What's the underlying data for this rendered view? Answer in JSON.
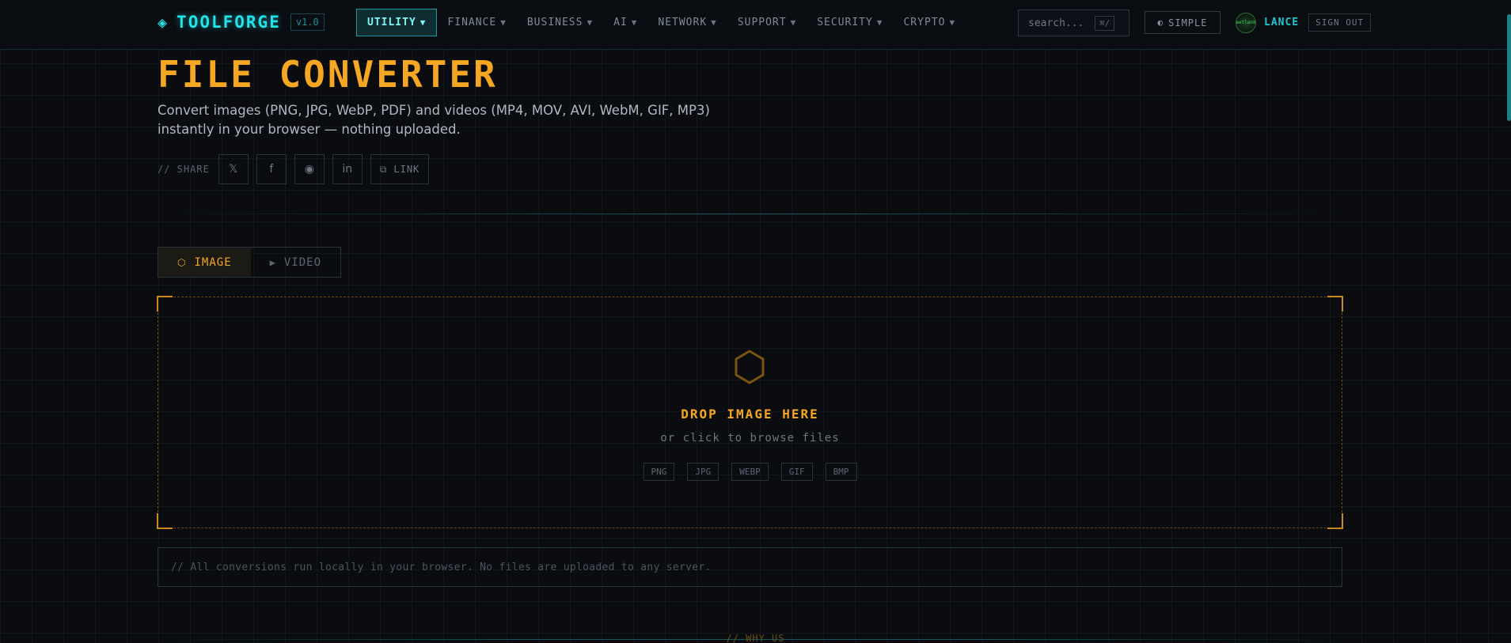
{
  "nav": {
    "logo_icon": "◈",
    "logo_text": "TOOLFORGE",
    "version": "v1.0",
    "menu": [
      {
        "label": "UTILITY",
        "active": true
      },
      {
        "label": "FINANCE",
        "active": false
      },
      {
        "label": "BUSINESS",
        "active": false
      },
      {
        "label": "AI",
        "active": false
      },
      {
        "label": "NETWORK",
        "active": false
      },
      {
        "label": "SUPPORT",
        "active": false
      },
      {
        "label": "SECURITY",
        "active": false
      },
      {
        "label": "CRYPTO",
        "active": false
      }
    ],
    "caret_icon": "▼",
    "search_placeholder": "search...",
    "search_shortcut": "⌘/",
    "simple_icon": "◐",
    "simple_label": "SIMPLE",
    "avatar_text": "aetlank",
    "username": "LANCE",
    "signout_label": "SIGN OUT"
  },
  "header": {
    "title": "FILE CONVERTER",
    "description_line1": "Convert images (PNG, JPG, WebP, PDF) and videos (MP4, MOV, AVI, WebM, GIF, MP3)",
    "description_line2": "instantly in your browser — nothing uploaded.",
    "share_label": "// SHARE",
    "share_buttons": {
      "x": "𝕏",
      "facebook": "f",
      "reddit": "◉",
      "linkedin": "in",
      "link_icon": "⧉",
      "link_label": "LINK"
    }
  },
  "tabs": {
    "image_icon": "⬡",
    "image_label": "IMAGE",
    "video_icon": "▶",
    "video_label": "VIDEO"
  },
  "dropzone": {
    "title": "DROP IMAGE HERE",
    "subtitle": "or click to browse files",
    "formats": [
      "PNG",
      "JPG",
      "WEBP",
      "GIF",
      "BMP"
    ]
  },
  "note": "// All conversions run locally in your browser. No files are uploaded to any server.",
  "why_label": "// WHY US",
  "colors": {
    "accent_cyan": "#22e3e8",
    "accent_orange": "#f5a623",
    "background": "#0a0c10"
  }
}
